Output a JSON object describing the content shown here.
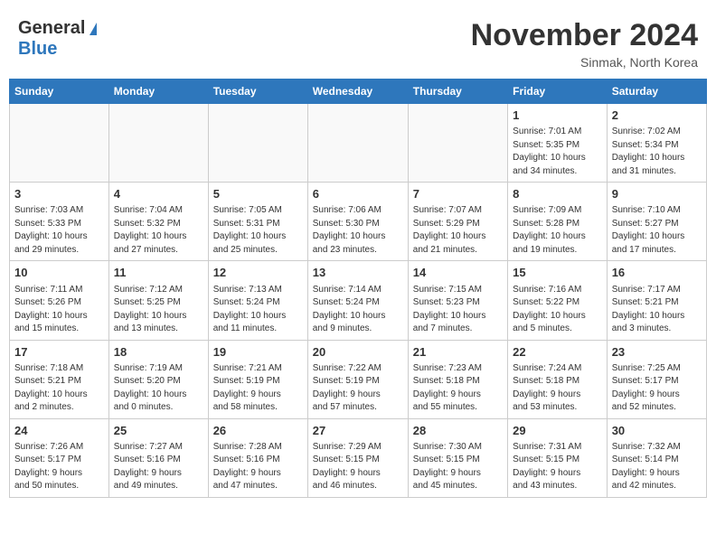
{
  "header": {
    "logo_general": "General",
    "logo_blue": "Blue",
    "month_title": "November 2024",
    "subtitle": "Sinmak, North Korea"
  },
  "calendar": {
    "days_of_week": [
      "Sunday",
      "Monday",
      "Tuesday",
      "Wednesday",
      "Thursday",
      "Friday",
      "Saturday"
    ],
    "weeks": [
      [
        {
          "day": "",
          "info": ""
        },
        {
          "day": "",
          "info": ""
        },
        {
          "day": "",
          "info": ""
        },
        {
          "day": "",
          "info": ""
        },
        {
          "day": "",
          "info": ""
        },
        {
          "day": "1",
          "info": "Sunrise: 7:01 AM\nSunset: 5:35 PM\nDaylight: 10 hours\nand 34 minutes."
        },
        {
          "day": "2",
          "info": "Sunrise: 7:02 AM\nSunset: 5:34 PM\nDaylight: 10 hours\nand 31 minutes."
        }
      ],
      [
        {
          "day": "3",
          "info": "Sunrise: 7:03 AM\nSunset: 5:33 PM\nDaylight: 10 hours\nand 29 minutes."
        },
        {
          "day": "4",
          "info": "Sunrise: 7:04 AM\nSunset: 5:32 PM\nDaylight: 10 hours\nand 27 minutes."
        },
        {
          "day": "5",
          "info": "Sunrise: 7:05 AM\nSunset: 5:31 PM\nDaylight: 10 hours\nand 25 minutes."
        },
        {
          "day": "6",
          "info": "Sunrise: 7:06 AM\nSunset: 5:30 PM\nDaylight: 10 hours\nand 23 minutes."
        },
        {
          "day": "7",
          "info": "Sunrise: 7:07 AM\nSunset: 5:29 PM\nDaylight: 10 hours\nand 21 minutes."
        },
        {
          "day": "8",
          "info": "Sunrise: 7:09 AM\nSunset: 5:28 PM\nDaylight: 10 hours\nand 19 minutes."
        },
        {
          "day": "9",
          "info": "Sunrise: 7:10 AM\nSunset: 5:27 PM\nDaylight: 10 hours\nand 17 minutes."
        }
      ],
      [
        {
          "day": "10",
          "info": "Sunrise: 7:11 AM\nSunset: 5:26 PM\nDaylight: 10 hours\nand 15 minutes."
        },
        {
          "day": "11",
          "info": "Sunrise: 7:12 AM\nSunset: 5:25 PM\nDaylight: 10 hours\nand 13 minutes."
        },
        {
          "day": "12",
          "info": "Sunrise: 7:13 AM\nSunset: 5:24 PM\nDaylight: 10 hours\nand 11 minutes."
        },
        {
          "day": "13",
          "info": "Sunrise: 7:14 AM\nSunset: 5:24 PM\nDaylight: 10 hours\nand 9 minutes."
        },
        {
          "day": "14",
          "info": "Sunrise: 7:15 AM\nSunset: 5:23 PM\nDaylight: 10 hours\nand 7 minutes."
        },
        {
          "day": "15",
          "info": "Sunrise: 7:16 AM\nSunset: 5:22 PM\nDaylight: 10 hours\nand 5 minutes."
        },
        {
          "day": "16",
          "info": "Sunrise: 7:17 AM\nSunset: 5:21 PM\nDaylight: 10 hours\nand 3 minutes."
        }
      ],
      [
        {
          "day": "17",
          "info": "Sunrise: 7:18 AM\nSunset: 5:21 PM\nDaylight: 10 hours\nand 2 minutes."
        },
        {
          "day": "18",
          "info": "Sunrise: 7:19 AM\nSunset: 5:20 PM\nDaylight: 10 hours\nand 0 minutes."
        },
        {
          "day": "19",
          "info": "Sunrise: 7:21 AM\nSunset: 5:19 PM\nDaylight: 9 hours\nand 58 minutes."
        },
        {
          "day": "20",
          "info": "Sunrise: 7:22 AM\nSunset: 5:19 PM\nDaylight: 9 hours\nand 57 minutes."
        },
        {
          "day": "21",
          "info": "Sunrise: 7:23 AM\nSunset: 5:18 PM\nDaylight: 9 hours\nand 55 minutes."
        },
        {
          "day": "22",
          "info": "Sunrise: 7:24 AM\nSunset: 5:18 PM\nDaylight: 9 hours\nand 53 minutes."
        },
        {
          "day": "23",
          "info": "Sunrise: 7:25 AM\nSunset: 5:17 PM\nDaylight: 9 hours\nand 52 minutes."
        }
      ],
      [
        {
          "day": "24",
          "info": "Sunrise: 7:26 AM\nSunset: 5:17 PM\nDaylight: 9 hours\nand 50 minutes."
        },
        {
          "day": "25",
          "info": "Sunrise: 7:27 AM\nSunset: 5:16 PM\nDaylight: 9 hours\nand 49 minutes."
        },
        {
          "day": "26",
          "info": "Sunrise: 7:28 AM\nSunset: 5:16 PM\nDaylight: 9 hours\nand 47 minutes."
        },
        {
          "day": "27",
          "info": "Sunrise: 7:29 AM\nSunset: 5:15 PM\nDaylight: 9 hours\nand 46 minutes."
        },
        {
          "day": "28",
          "info": "Sunrise: 7:30 AM\nSunset: 5:15 PM\nDaylight: 9 hours\nand 45 minutes."
        },
        {
          "day": "29",
          "info": "Sunrise: 7:31 AM\nSunset: 5:15 PM\nDaylight: 9 hours\nand 43 minutes."
        },
        {
          "day": "30",
          "info": "Sunrise: 7:32 AM\nSunset: 5:14 PM\nDaylight: 9 hours\nand 42 minutes."
        }
      ]
    ]
  }
}
